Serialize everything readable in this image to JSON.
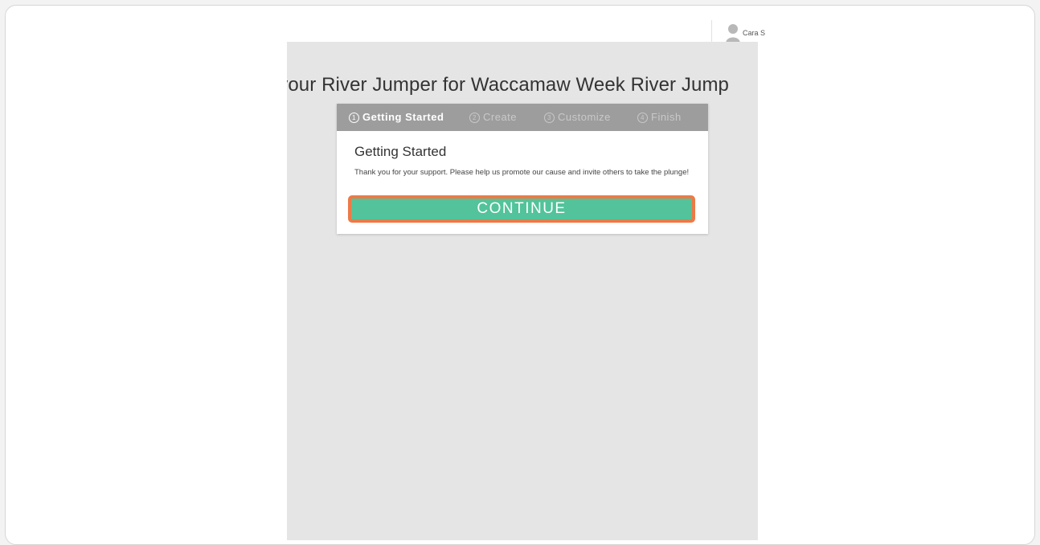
{
  "user": {
    "name": "Cara S",
    "avatar_icon": "user-silhouette-icon"
  },
  "page": {
    "title": "ate your River Jumper for Waccamaw Week River Jump"
  },
  "wizard": {
    "steps": [
      {
        "number": "1",
        "label": "Getting Started",
        "active": true
      },
      {
        "number": "2",
        "label": "Create",
        "active": false
      },
      {
        "number": "3",
        "label": "Customize",
        "active": false
      },
      {
        "number": "4",
        "label": "Finish",
        "active": false
      }
    ],
    "heading": "Getting Started",
    "message": "Thank you for your support. Please help us promote our cause and invite others to take the plunge!",
    "continue_label": "CONTINUE"
  },
  "colors": {
    "accent_green": "#52c39a",
    "highlight_orange": "#ec7a47",
    "step_bar": "#9d9d9d",
    "panel_bg": "#e5e5e5"
  }
}
